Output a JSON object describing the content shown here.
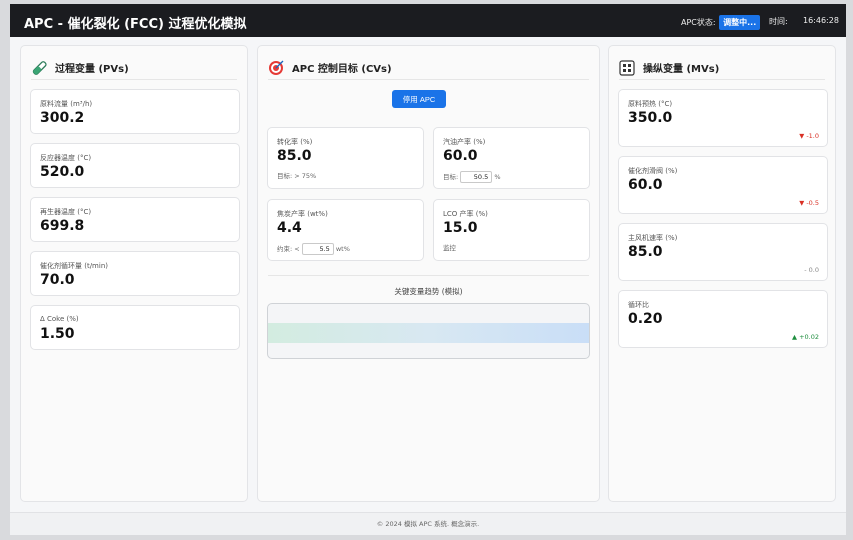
{
  "header": {
    "title": "APC - 催化裂化 (FCC) 过程优化模拟",
    "status_label": "APC状态:",
    "status_value": "调整中...",
    "time_label": "时间:",
    "time_value": "16:46:28"
  },
  "pv_panel": {
    "title": "过程变量 (PVs)",
    "icon": "test-tube-icon",
    "items": [
      {
        "label": "原料流量 (m³/h)",
        "value": "300.2"
      },
      {
        "label": "反应器温度 (°C)",
        "value": "520.0"
      },
      {
        "label": "再生器温度 (°C)",
        "value": "699.8"
      },
      {
        "label": "催化剂循环量 (t/min)",
        "value": "70.0"
      },
      {
        "label": "Δ Coke (%)",
        "value": "1.50"
      }
    ]
  },
  "cv_panel": {
    "title": "APC 控制目标 (CVs)",
    "icon": "target-icon",
    "toggle_button": "停用 APC",
    "items": [
      {
        "label": "转化率 (%)",
        "value": "85.0",
        "sub": "目标: > 75%"
      },
      {
        "label": "汽油产率 (%)",
        "value": "60.0",
        "sub_prefix": "目标:",
        "input_value": "50.5",
        "sub_suffix": "%"
      },
      {
        "label": "焦炭产率 (wt%)",
        "value": "4.4",
        "sub_prefix": "约束: <",
        "input_value": "5.5",
        "sub_suffix": "wt%"
      },
      {
        "label": "LCO 产率 (%)",
        "value": "15.0",
        "sub": "监控"
      }
    ],
    "trend_title": "关键变量趋势 (模拟)"
  },
  "mv_panel": {
    "title": "操纵变量 (MVs)",
    "icon": "control-panel-icon",
    "items": [
      {
        "label": "原料预热 (°C)",
        "value": "350.0",
        "delta": "▼ -1.0",
        "trend": "down"
      },
      {
        "label": "催化剂滑阀 (%)",
        "value": "60.0",
        "delta": "▼ -0.5",
        "trend": "down"
      },
      {
        "label": "主风机速率 (%)",
        "value": "85.0",
        "delta": "- 0.0",
        "trend": "flat"
      },
      {
        "label": "循环比",
        "value": "0.20",
        "delta": "▲ +0.02",
        "trend": "up"
      }
    ]
  },
  "footer": {
    "text": "© 2024 模拟 APC 系统. 概念演示."
  },
  "colors": {
    "accent": "#1a73e8",
    "topbar": "#1b1c20",
    "down": "#d93025",
    "up": "#1e8e3e"
  }
}
